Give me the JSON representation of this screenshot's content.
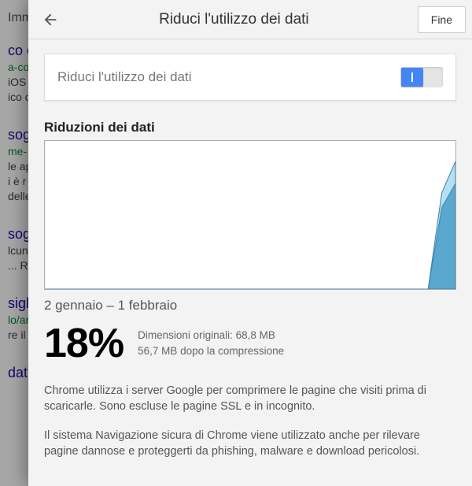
{
  "header": {
    "title": "Riduci l'utilizzo dei dati",
    "done_label": "Fine"
  },
  "toggle": {
    "label": "Riduci l'utilizzo dei dati",
    "enabled": true
  },
  "section_title": "Riduzioni dei dati",
  "date_range": "2 gennaio – 1 febbraio",
  "percent": "18%",
  "stats": {
    "original": "Dimensioni originali: 68,8 MB",
    "compressed": "56,7 MB dopo la compressione"
  },
  "paragraph1": "Chrome utilizza i server Google per comprimere le pagine che visiti prima di scaricarle. Sono escluse le pagine SSL e in incognito.",
  "paragraph2": "Il sistema Navigazione sicura di Chrome viene utilizzato anche per rilevare pagine dannose e proteggerti da phishing, malware e download pericolosi.",
  "chart_data": {
    "type": "area",
    "xlabel": "",
    "ylabel": "",
    "x_range_days": 31,
    "series": [
      {
        "name": "original",
        "color": "#b6dff2",
        "values": [
          0,
          0,
          0,
          0,
          0,
          0,
          0,
          0,
          0,
          0,
          0,
          0,
          0,
          0,
          0,
          0,
          0,
          0,
          0,
          0,
          0,
          0,
          0,
          0,
          0,
          0,
          0,
          0,
          0,
          52,
          69
        ]
      },
      {
        "name": "compressed",
        "color": "#5aa7d0",
        "values": [
          0,
          0,
          0,
          0,
          0,
          0,
          0,
          0,
          0,
          0,
          0,
          0,
          0,
          0,
          0,
          0,
          0,
          0,
          0,
          0,
          0,
          0,
          0,
          0,
          0,
          0,
          0,
          0,
          0,
          44,
          57
        ]
      }
    ],
    "ylim": [
      0,
      80
    ]
  },
  "background": {
    "imm_label": "Imm",
    "snippets": [
      {
        "title": "co c",
        "green": "a-co",
        "grey1": "iOS",
        "grey2": "ico c"
      },
      {
        "title": "sogl",
        "green": "me-",
        "grey1": "le ap",
        "grey2": "i è r",
        "grey3": "delle"
      },
      {
        "title": "sogl",
        "green": "",
        "grey1": "lcuni",
        "grey2": "... Ri"
      },
      {
        "title": "siglia",
        "green": "lo/ar",
        "grey1": "re il"
      },
      {
        "title": "dati su Android - ilSoftware.it",
        "green": "",
        "grey1": ""
      }
    ]
  }
}
